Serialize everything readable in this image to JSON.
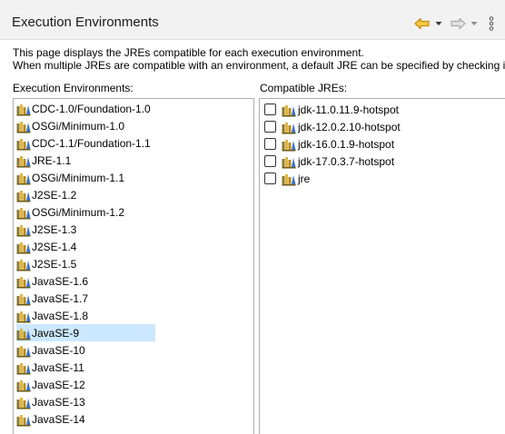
{
  "header": {
    "title": "Execution Environments"
  },
  "description": {
    "line1": "This page displays the JREs compatible for each execution environment.",
    "line2": "When multiple JREs are compatible with an environment, a default JRE can be specified by checking it."
  },
  "environments": {
    "label": "Execution Environments:",
    "selected_index": 18,
    "items": [
      "CDC-1.0/Foundation-1.0",
      "OSGi/Minimum-1.0",
      "CDC-1.1/Foundation-1.1",
      "JRE-1.1",
      "OSGi/Minimum-1.1",
      "J2SE-1.2",
      "OSGi/Minimum-1.2",
      "J2SE-1.3",
      "J2SE-1.4",
      "J2SE-1.5",
      "JavaSE-1.6",
      "JavaSE-1.7",
      "JavaSE-1.8",
      "JavaSE-9",
      "JavaSE-10",
      "JavaSE-11",
      "JavaSE-12",
      "JavaSE-13",
      "JavaSE-14"
    ]
  },
  "compatible_jres": {
    "label": "Compatible JREs:",
    "items": [
      "jdk-11.0.11.9-hotspot",
      "jdk-12.0.2.10-hotspot",
      "jdk-16.0.1.9-hotspot",
      "jdk-17.0.3.7-hotspot",
      "jre"
    ]
  },
  "colors": {
    "selection": "#cce8ff",
    "back_arrow": "#e8a317",
    "forward_arrow": "#b0b0b0"
  },
  "icons": {
    "back": "back-arrow-icon",
    "back_menu": "chevron-down-icon",
    "forward": "forward-arrow-icon",
    "forward_menu": "chevron-down-icon",
    "view_menu": "kebab-menu-icon",
    "library": "jre-library-icon"
  }
}
